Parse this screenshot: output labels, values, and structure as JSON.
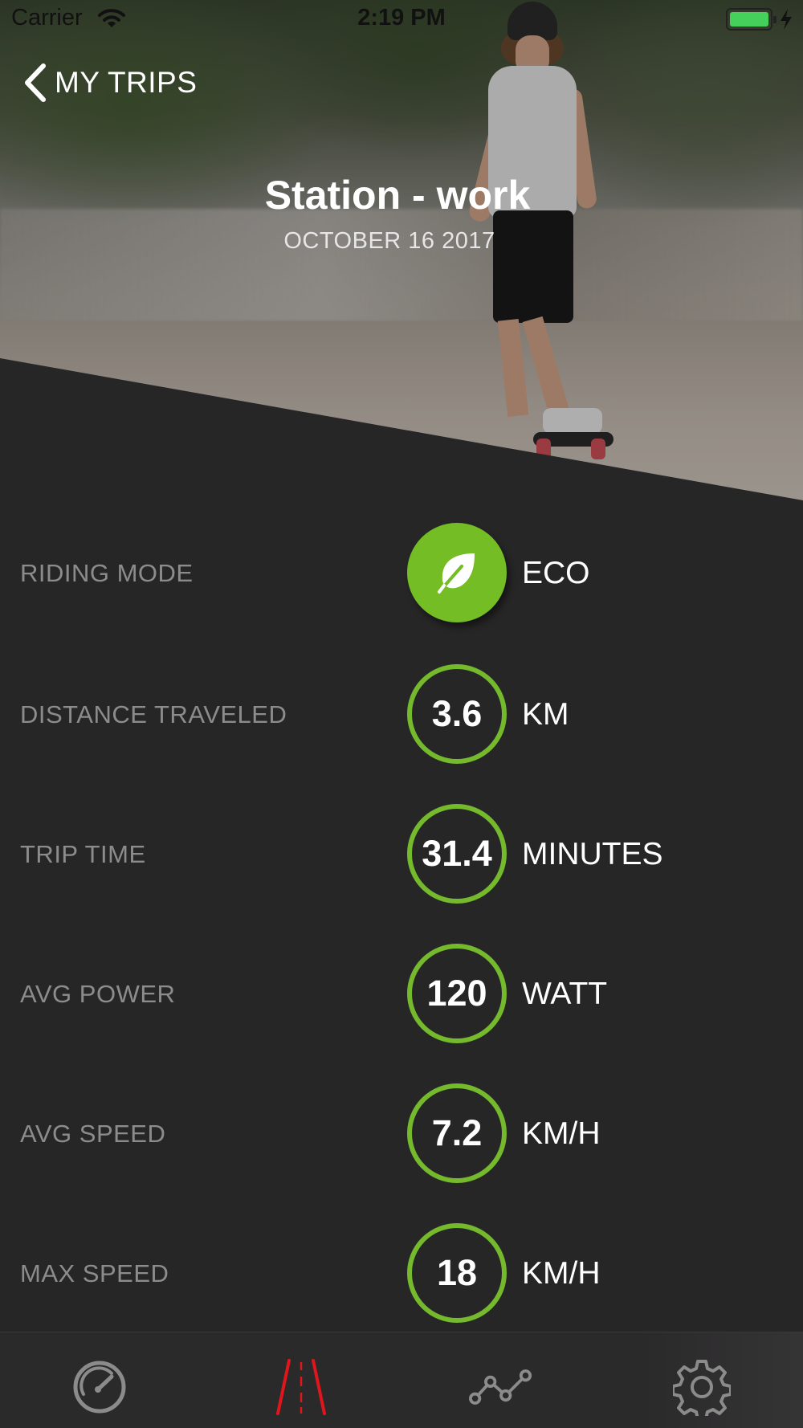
{
  "status_bar": {
    "carrier": "Carrier",
    "time": "2:19 PM",
    "battery_color": "#44d05a"
  },
  "nav": {
    "back_label": "MY TRIPS",
    "back_icon": "chevron-left-icon"
  },
  "trip": {
    "title": "Station - work",
    "date": "OCTOBER 16 2017",
    "hero_image": "skateboarder-photo"
  },
  "stats": [
    {
      "label": "RIDING MODE",
      "value": "",
      "unit": "ECO",
      "icon": "leaf-icon"
    },
    {
      "label": "DISTANCE TRAVELED",
      "value": "3.6",
      "unit": "KM"
    },
    {
      "label": "TRIP TIME",
      "value": "31.4",
      "unit": "MINUTES"
    },
    {
      "label": "AVG POWER",
      "value": "120",
      "unit": "WATT"
    },
    {
      "label": "AVG SPEED",
      "value": "7.2",
      "unit": "KM/H"
    },
    {
      "label": "MAX SPEED",
      "value": "18",
      "unit": "KM/H"
    }
  ],
  "tab_bar": {
    "tabs": [
      {
        "name": "speedometer-icon",
        "active": false
      },
      {
        "name": "road-icon",
        "active": true
      },
      {
        "name": "stats-graph-icon",
        "active": false
      },
      {
        "name": "settings-gear-icon",
        "active": false
      }
    ]
  },
  "colors": {
    "accent_green": "#75b92c",
    "active_tab_red": "#e0161c",
    "background": "#272627",
    "label_gray": "#8d8c8d"
  }
}
